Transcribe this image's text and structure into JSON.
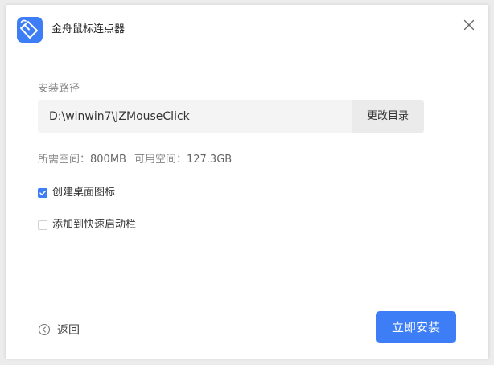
{
  "app": {
    "title": "金舟鼠标连点器",
    "logo_icon": "mouse-icon",
    "accent_color": "#3d7df5"
  },
  "install": {
    "path_label": "安装路径",
    "path_value": "D:\\winwin7\\JZMouseClick",
    "change_dir_label": "更改目录",
    "required_label": "所需空间：",
    "required_value": "800MB",
    "available_label": "可用空间：",
    "available_value": "127.3GB"
  },
  "options": [
    {
      "label": "创建桌面图标",
      "checked": true
    },
    {
      "label": "添加到快速启动栏",
      "checked": false
    }
  ],
  "footer": {
    "back_label": "返回",
    "install_label": "立即安装"
  }
}
